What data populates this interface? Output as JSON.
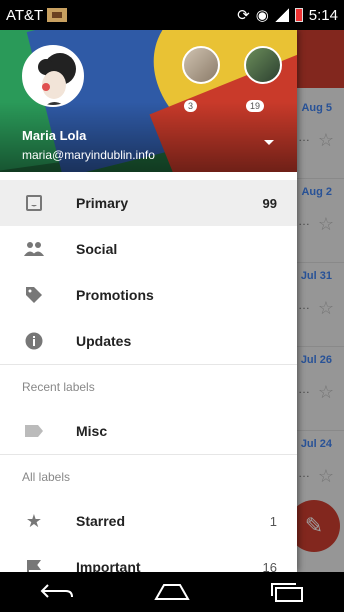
{
  "status_bar": {
    "carrier": "AT&T",
    "time": "5:14"
  },
  "background_list": {
    "dates": [
      "Aug 5",
      "Aug 2",
      "Jul 31",
      "Jul 26",
      "Jul 24"
    ]
  },
  "account": {
    "name": "Maria Lola",
    "email": "maria@maryindublin.info",
    "other_accounts": [
      {
        "count": "3"
      },
      {
        "count": "19"
      }
    ]
  },
  "menu": {
    "items": [
      {
        "label": "Primary",
        "count": "99",
        "icon": "inbox-icon"
      },
      {
        "label": "Social",
        "count": "",
        "icon": "people-icon"
      },
      {
        "label": "Promotions",
        "count": "",
        "icon": "tag-icon"
      },
      {
        "label": "Updates",
        "count": "",
        "icon": "info-icon"
      }
    ],
    "recent_labels_header": "Recent labels",
    "recent_labels": [
      {
        "label": "Misc",
        "icon": "label-icon"
      }
    ],
    "all_labels_header": "All labels",
    "all_labels": [
      {
        "label": "Starred",
        "count": "1",
        "icon": "star-icon"
      },
      {
        "label": "Important",
        "count": "16",
        "icon": "important-icon"
      }
    ]
  },
  "colors": {
    "accent": "#d23f31",
    "date_blue": "#4285f4"
  },
  "nav_bar": {
    "icons": [
      "back-icon",
      "home-icon",
      "recents-icon"
    ]
  }
}
